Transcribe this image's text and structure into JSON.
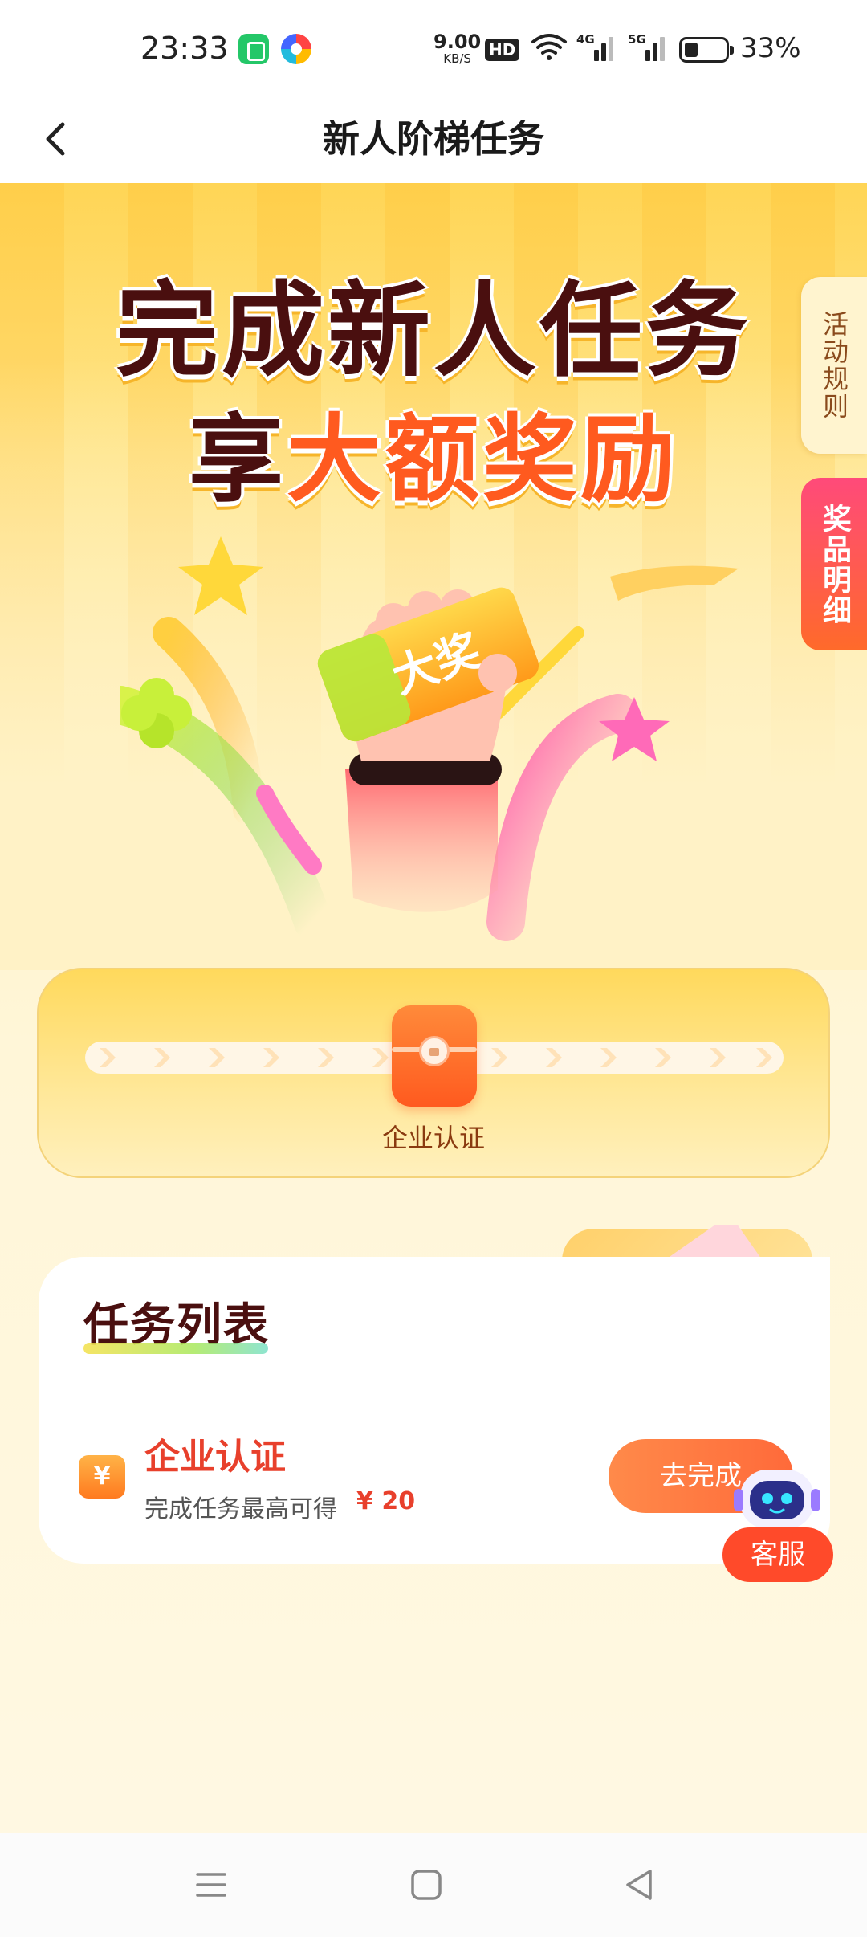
{
  "status_bar": {
    "time": "23:33",
    "net_speed_value": "9.00",
    "net_speed_unit": "KB/S",
    "hd_label": "HD",
    "signal_1_label": "4G",
    "signal_2_label": "5G",
    "battery": "33%",
    "battery_level": 0.33
  },
  "header": {
    "title": "新人阶梯任务"
  },
  "hero": {
    "line1": "完成新人任务",
    "line2_prefix": "享",
    "line2_highlight": "大额奖励",
    "ticket_text": "大奖"
  },
  "side_tabs": {
    "rules": "活动规则",
    "prizes": "奖品明细"
  },
  "progress": {
    "milestone_label": "企业认证"
  },
  "task_list": {
    "title": "任务列表",
    "items": [
      {
        "icon_glyph": "¥",
        "name": "企业认证",
        "desc": "完成任务最高可得",
        "reward": "¥ 20",
        "button": "去完成"
      }
    ]
  },
  "customer_service": {
    "label": "客服"
  },
  "colors": {
    "accent": "#ff5a1f",
    "brand_dark": "#4a0f0f",
    "task_red": "#e8402c"
  }
}
